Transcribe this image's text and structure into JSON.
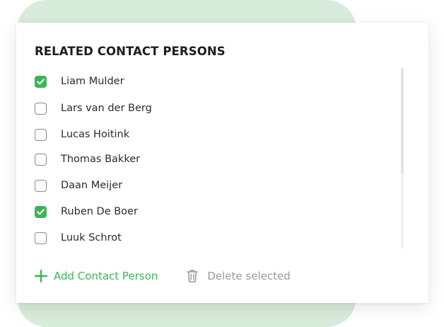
{
  "panel": {
    "title": "RELATED CONTACT PERSONS"
  },
  "contacts": [
    {
      "name": "Liam Mulder",
      "checked": true
    },
    {
      "name": "Lars van der Berg",
      "checked": false
    },
    {
      "name": "Lucas Hoitink",
      "checked": false
    },
    {
      "name": "Thomas Bakker",
      "checked": false
    },
    {
      "name": "Daan Meijer",
      "checked": false
    },
    {
      "name": "Ruben De Boer",
      "checked": true
    },
    {
      "name": "Luuk Schrot",
      "checked": false
    }
  ],
  "actions": {
    "add_label": "Add Contact Person",
    "add_icon": "plus-icon",
    "delete_label": "Delete selected",
    "delete_icon": "trash-icon"
  },
  "colors": {
    "accent": "#3cb554",
    "background_blob": "#d8ecdb",
    "muted": "#9a9a9a"
  }
}
